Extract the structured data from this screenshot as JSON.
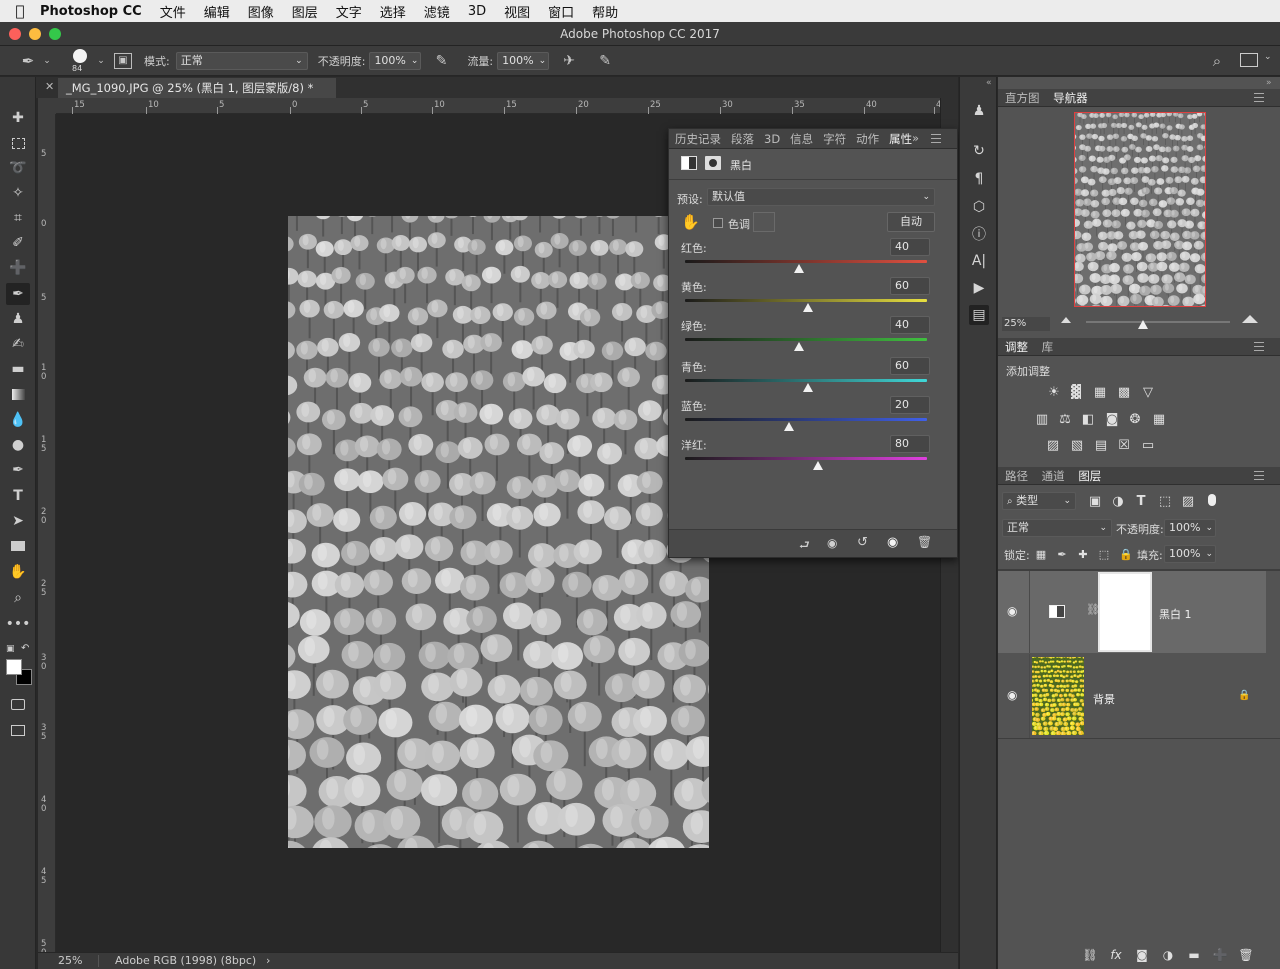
{
  "menubar": {
    "app": "Photoshop CC",
    "items": [
      "文件",
      "编辑",
      "图像",
      "图层",
      "文字",
      "选择",
      "滤镜",
      "3D",
      "视图",
      "窗口",
      "帮助"
    ]
  },
  "window": {
    "title": "Adobe Photoshop CC 2017"
  },
  "options": {
    "brush_size": "84",
    "mode_label": "模式:",
    "mode_value": "正常",
    "opacity_label": "不透明度:",
    "opacity_value": "100%",
    "flow_label": "流量:",
    "flow_value": "100%"
  },
  "document": {
    "tab_title": "_MG_1090.JPG @ 25% (黑白 1, 图层蒙版/8) *",
    "zoom": "25%",
    "color_profile": "Adobe RGB (1998) (8bpc)",
    "hruler_labels": [
      "15",
      "10",
      "5",
      "0",
      "5",
      "10",
      "15",
      "20",
      "25",
      "30",
      "35",
      "40",
      "4"
    ],
    "vruler_labels": [
      "5",
      "0",
      "5",
      "1 0",
      "1 5",
      "2 0",
      "2 5",
      "3 0",
      "3 5",
      "4 0",
      "4 5",
      "5 0"
    ]
  },
  "properties": {
    "tabs": [
      "历史记录",
      "段落",
      "3D",
      "信息",
      "字符",
      "动作",
      "属性"
    ],
    "active_tab": "属性",
    "adjustment_name": "黑白",
    "preset_label": "预设:",
    "preset_value": "默认值",
    "tint_label": "色调",
    "auto_label": "自动",
    "sliders": [
      {
        "label": "红色:",
        "value": "40",
        "pos": 0.47
      },
      {
        "label": "黄色:",
        "value": "60",
        "pos": 0.51
      },
      {
        "label": "绿色:",
        "value": "40",
        "pos": 0.47
      },
      {
        "label": "青色:",
        "value": "60",
        "pos": 0.51
      },
      {
        "label": "蓝色:",
        "value": "20",
        "pos": 0.43
      },
      {
        "label": "洋红:",
        "value": "80",
        "pos": 0.55
      }
    ]
  },
  "navigator": {
    "tabs": [
      "直方图",
      "导航器"
    ],
    "active_tab": "导航器",
    "zoom": "25%"
  },
  "adjustments": {
    "tabs": [
      "调整",
      "库"
    ],
    "active_tab": "调整",
    "add_label": "添加调整"
  },
  "layers": {
    "tabs": [
      "路径",
      "通道",
      "图层"
    ],
    "active_tab": "图层",
    "filter_kind": "类型",
    "blend_mode": "正常",
    "opacity_label": "不透明度:",
    "opacity_value": "100%",
    "lock_label": "锁定:",
    "fill_label": "填充:",
    "fill_value": "100%",
    "items": [
      {
        "name": "黑白 1"
      },
      {
        "name": "背景"
      }
    ]
  },
  "colors": {
    "accent_nav": "#e04040"
  }
}
